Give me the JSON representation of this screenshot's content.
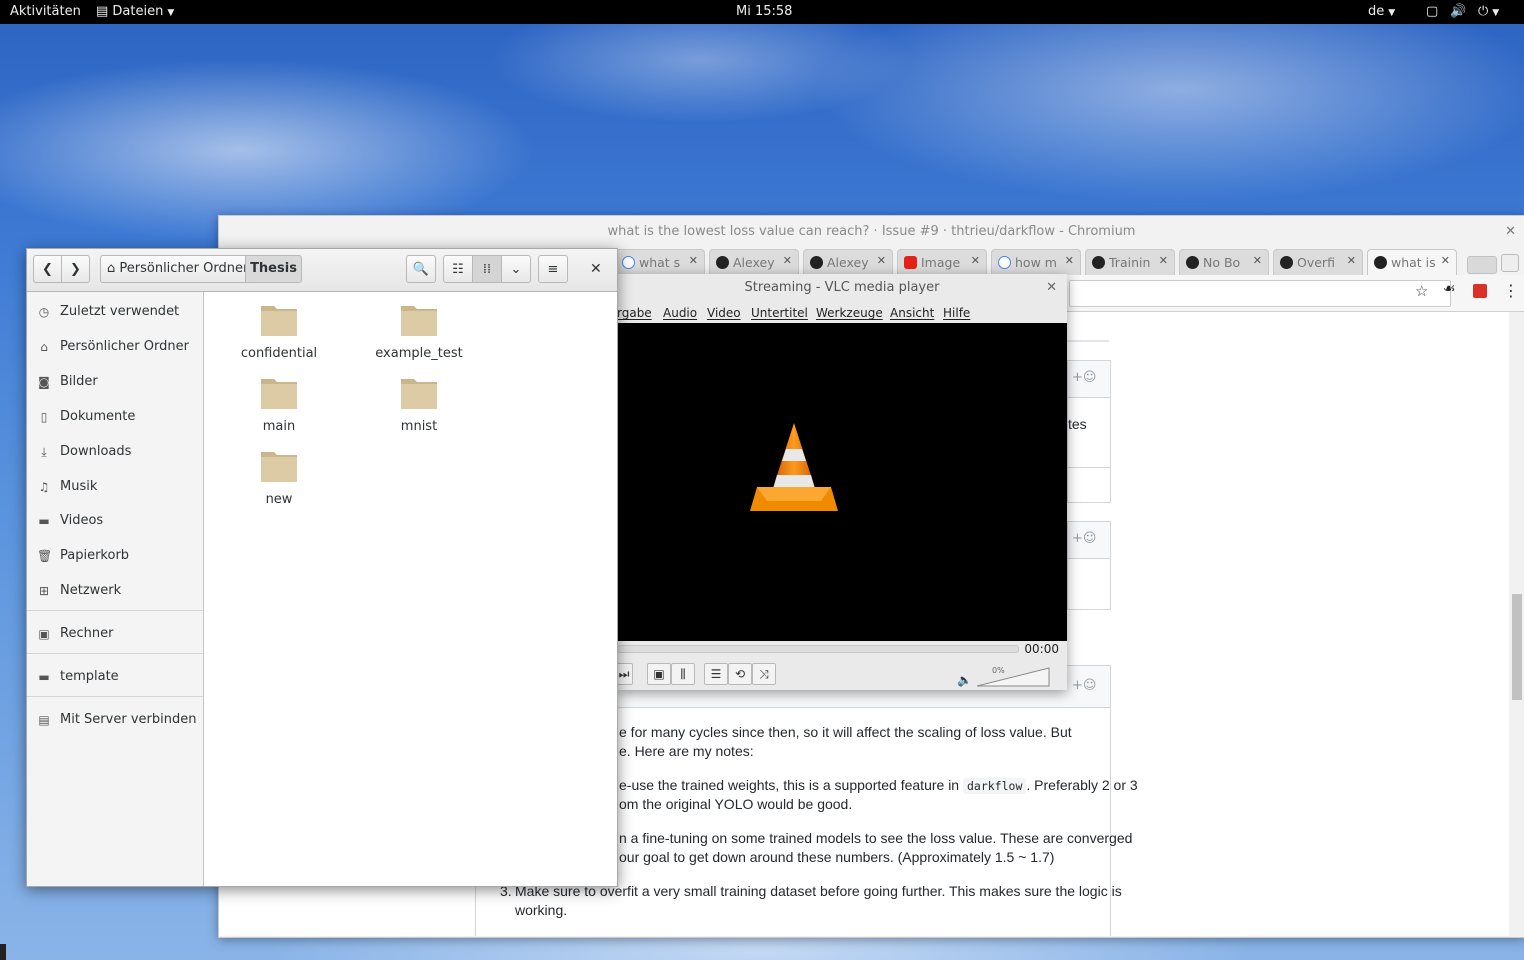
{
  "topbar": {
    "activities": "Aktivitäten",
    "app_menu": "Dateien",
    "clock": "Mi 15:58",
    "keyboard_layout": "de"
  },
  "chromium": {
    "title": "what is the lowest loss value can reach? · Issue #9 · thtrieu/darkflow - Chromium",
    "tabs": [
      {
        "label": "what s",
        "favicon": "google-icon"
      },
      {
        "label": "Alexey",
        "favicon": "github-icon"
      },
      {
        "label": "Alexey",
        "favicon": "github-icon"
      },
      {
        "label": "Image",
        "favicon": "youtube-icon"
      },
      {
        "label": "how m",
        "favicon": "google-icon"
      },
      {
        "label": "Trainin",
        "favicon": "github-icon"
      },
      {
        "label": "No Bo",
        "favicon": "github-icon"
      },
      {
        "label": "Overfi",
        "favicon": "github-icon"
      },
      {
        "label": "what is",
        "favicon": "github-icon"
      }
    ],
    "page": {
      "fragment_tes": "tes",
      "line1": "e for many cycles since then, so it will affect the scaling of loss value. But",
      "line2": "e. Here are my notes:",
      "line3a": "e-use the trained weights, this is a supported feature in",
      "code": "darkflow",
      "line3b": ". Preferably 2 or 3",
      "line4": "om the original YOLO would be good.",
      "line5": "n a fine-tuning on some trained models to see the loss value. These are converged",
      "line6": "our goal to get down around these numbers. (Approximately 1.5 ~ 1.7)",
      "item3_num": "3.",
      "item3_line1": "Make sure to overfit a very small training dataset before going further. This makes sure the logic is",
      "item3_line2": "working.",
      "emoji_plus": "+☺"
    }
  },
  "vlc": {
    "title": "Streaming - VLC media player",
    "menu": [
      "rgabe",
      "Audio",
      "Video",
      "Untertitel",
      "Werkzeuge",
      "Ansicht",
      "Hilfe"
    ],
    "time": "00:00",
    "volume_label": "0%",
    "volume": 0
  },
  "nautilus": {
    "breadcrumb_home": "Persönlicher Ordner",
    "breadcrumb_current": "Thesis",
    "sidebar": [
      {
        "label": "Zuletzt verwendet",
        "icon": "clock-icon"
      },
      {
        "label": "Persönlicher Ordner",
        "icon": "home-icon"
      },
      {
        "label": "Bilder",
        "icon": "camera-icon"
      },
      {
        "label": "Dokumente",
        "icon": "document-icon"
      },
      {
        "label": "Downloads",
        "icon": "download-icon"
      },
      {
        "label": "Musik",
        "icon": "music-icon"
      },
      {
        "label": "Videos",
        "icon": "video-icon"
      },
      {
        "label": "Papierkorb",
        "icon": "trash-icon"
      },
      {
        "label": "Netzwerk",
        "icon": "network-icon"
      },
      {
        "label": "Rechner",
        "icon": "computer-icon"
      },
      {
        "label": "template",
        "icon": "folder-icon"
      },
      {
        "label": "Mit Server verbinden",
        "icon": "server-icon"
      }
    ],
    "folders": [
      "confidential",
      "example_test",
      "main",
      "mnist",
      "new"
    ]
  },
  "colors": {
    "folder": "#d7c7a2",
    "vlc_cone": "#f08a00"
  }
}
